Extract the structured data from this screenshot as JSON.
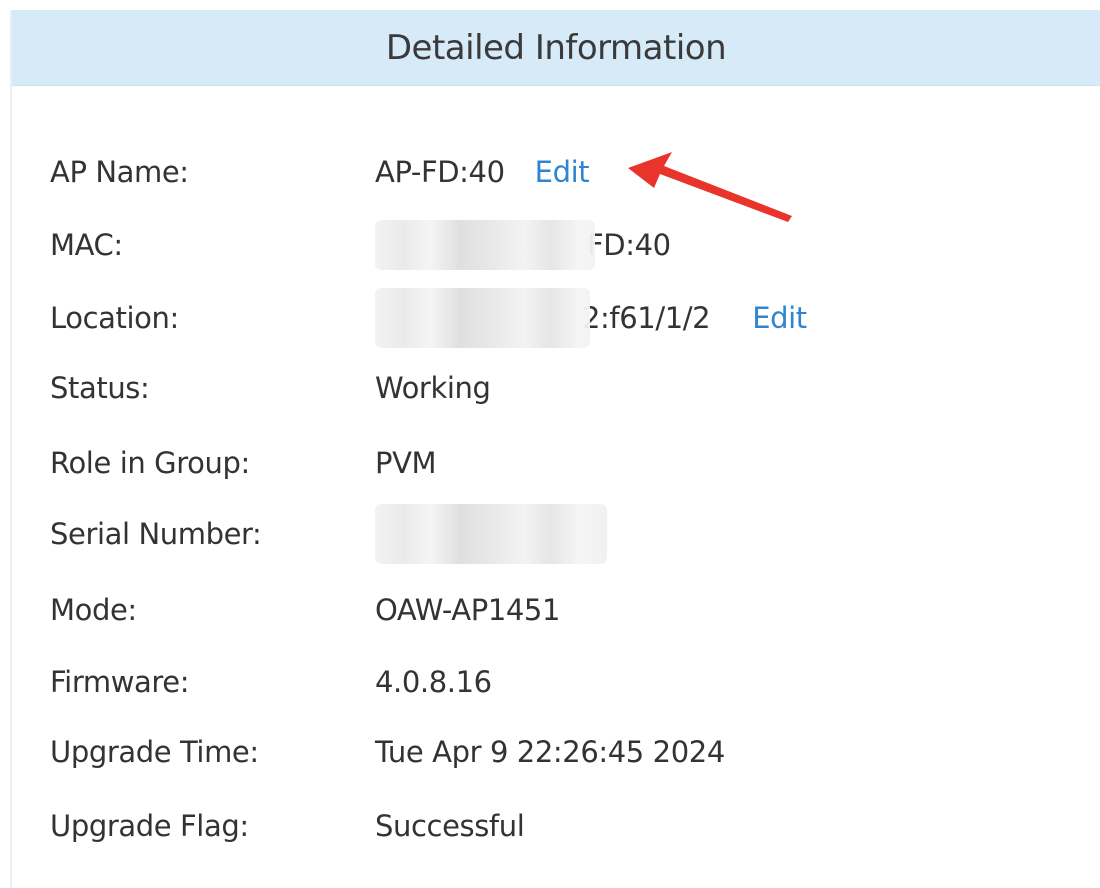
{
  "panel": {
    "title": "Detailed Information"
  },
  "rows": [
    {
      "label": "AP Name:",
      "value": "AP-FD:40",
      "edit": "Edit"
    },
    {
      "label": "MAC:",
      "value_tail": "FD:40"
    },
    {
      "label": "Location:",
      "value_tail": "2:f61/1/2",
      "edit": "Edit"
    },
    {
      "label": "Status:",
      "value": "Working"
    },
    {
      "label": "Role in Group:",
      "value": "PVM"
    },
    {
      "label": "Serial Number:",
      "value": ""
    },
    {
      "label": "Mode:",
      "value": "OAW-AP1451"
    },
    {
      "label": "Firmware:",
      "value": "4.0.8.16"
    },
    {
      "label": "Upgrade Time:",
      "value": "Tue Apr 9 22:26:45 2024"
    },
    {
      "label": "Upgrade Flag:",
      "value": "Successful"
    }
  ],
  "colors": {
    "header_bg": "#d6eaf8",
    "link": "#2f86cf",
    "arrow": "#e8342a"
  },
  "annotation": {
    "icon": "red-arrow-icon"
  }
}
